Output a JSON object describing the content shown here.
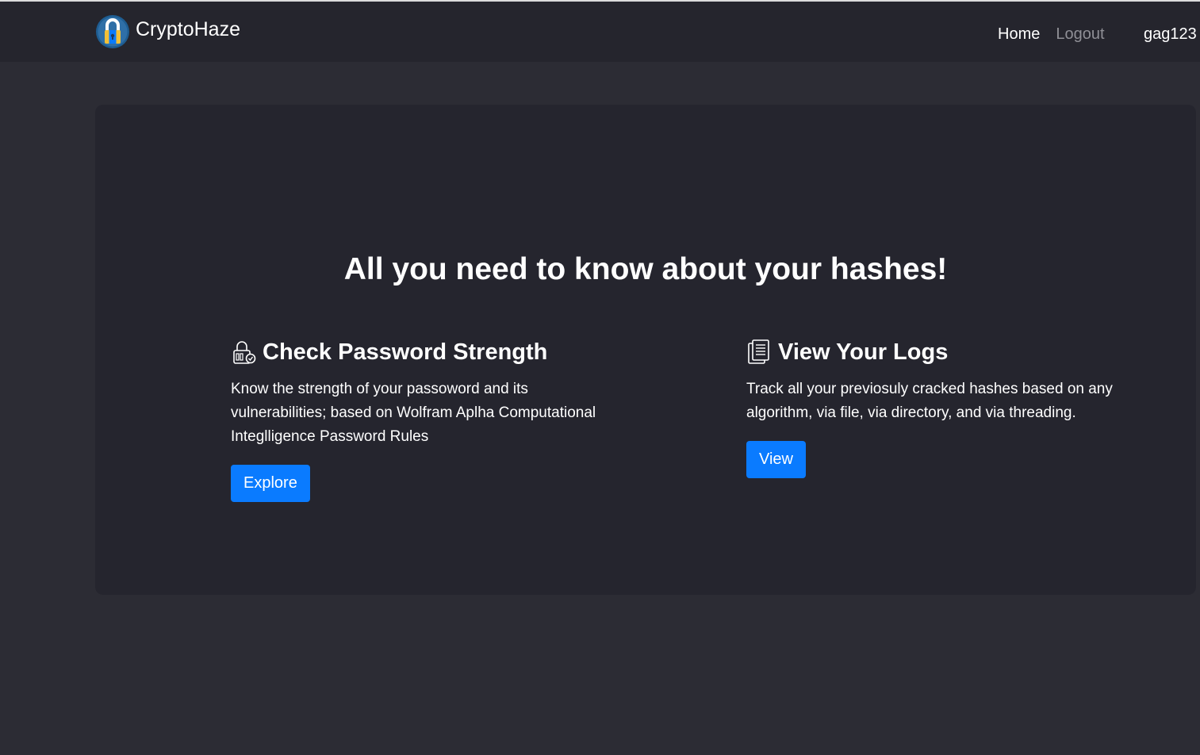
{
  "brand": {
    "name": "CryptoHaze",
    "logo_icon": "padlock-icon",
    "accent": "#0a7bff"
  },
  "nav": {
    "home_label": "Home",
    "logout_label": "Logout",
    "username": "gag123"
  },
  "hero": {
    "title": "All you need to know about your hashes!"
  },
  "features": [
    {
      "icon": "password-lock-icon",
      "title": "Check Password Strength",
      "text": "Know the strength of your passoword and its vulnerabilities; based on Wolfram Aplha Computational Integlligence Password Rules",
      "button_label": "Explore"
    },
    {
      "icon": "document-log-icon",
      "title": "View Your Logs",
      "text": "Track all your previosuly cracked hashes based on any algorithm, via file, via directory, and via threading.",
      "button_label": "View"
    }
  ],
  "colors": {
    "page_background": "#2c2c34",
    "navbar_background": "#25252d",
    "card_background": "#25252e",
    "button": "#0a7bff",
    "muted_link": "#8f8f96"
  }
}
